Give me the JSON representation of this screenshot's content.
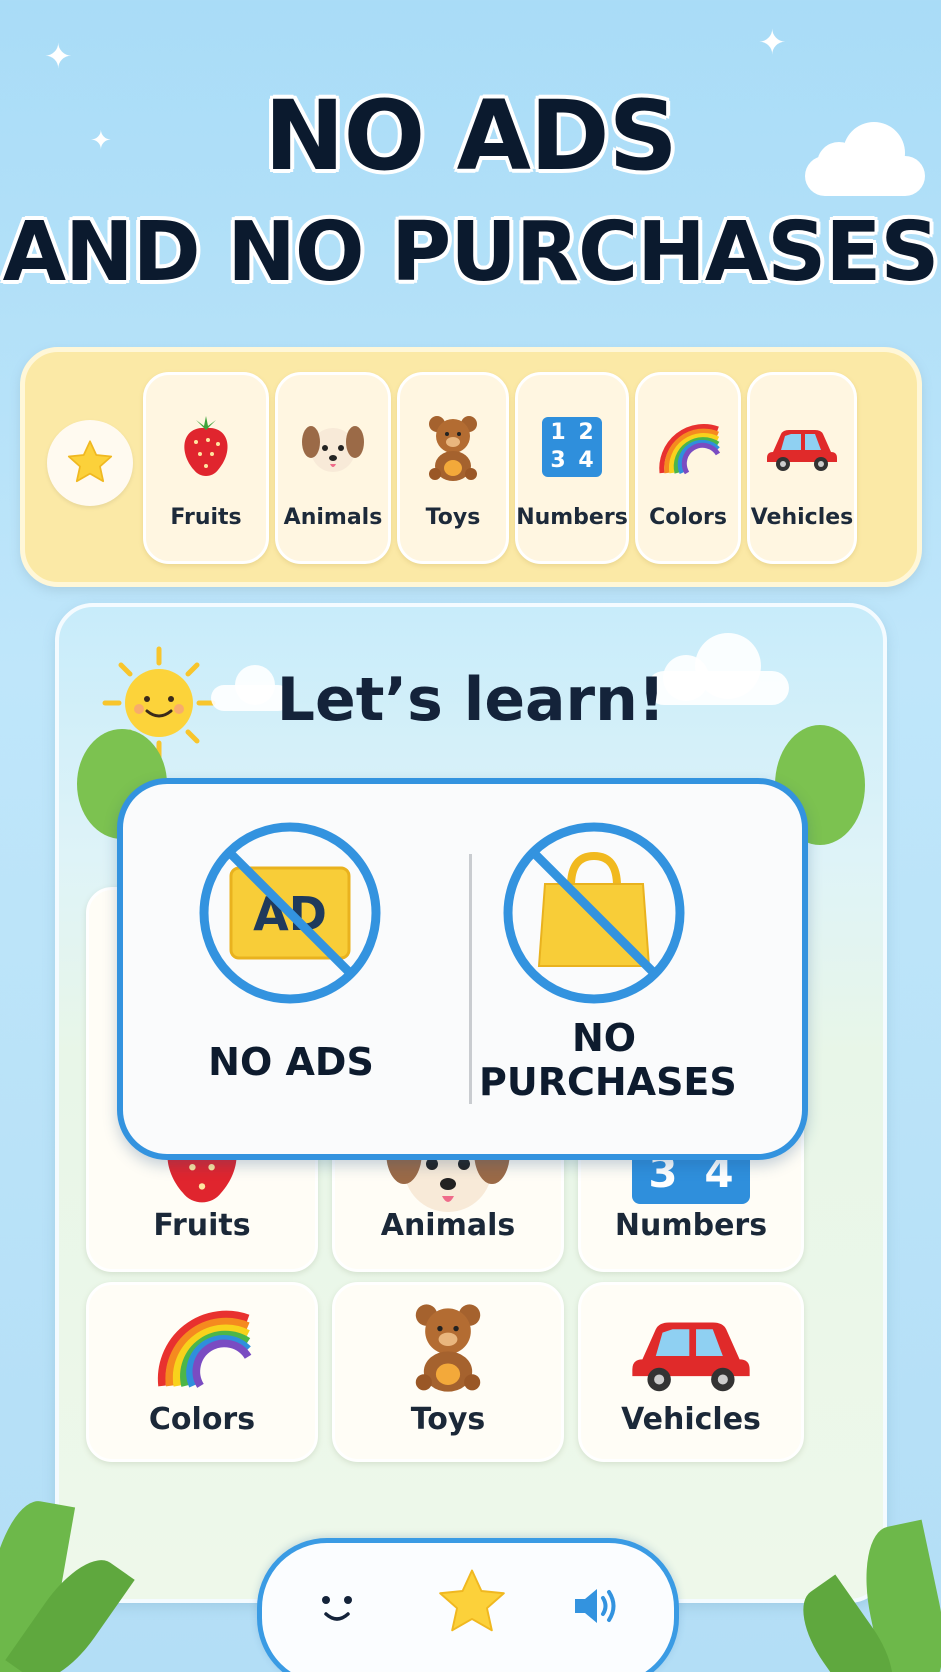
{
  "headline": {
    "line1": "NO ADS",
    "line2": "AND NO PURCHASES"
  },
  "category_strip": {
    "favorite_icon": "star-icon",
    "items": [
      {
        "label": "Fruits",
        "icon": "strawberry-icon"
      },
      {
        "label": "Animals",
        "icon": "puppy-icon"
      },
      {
        "label": "Toys",
        "icon": "teddy-bear-icon"
      },
      {
        "label": "Numbers",
        "icon": "numbers-icon"
      },
      {
        "label": "Colors",
        "icon": "rainbow-icon"
      },
      {
        "label": "Vehicles",
        "icon": "car-icon"
      }
    ]
  },
  "main": {
    "title": "Let’s learn!",
    "grid": [
      {
        "label": "Fruits",
        "icon": "strawberry-icon"
      },
      {
        "label": "Animals",
        "icon": "puppy-icon"
      },
      {
        "label": "Numbers",
        "icon": "numbers-icon"
      },
      {
        "label": "Colors",
        "icon": "rainbow-icon"
      },
      {
        "label": "Toys",
        "icon": "teddy-bear-icon"
      },
      {
        "label": "Vehicles",
        "icon": "car-icon"
      }
    ]
  },
  "notice": {
    "no_ads_label": "NO ADS",
    "no_ads_icon_text": "AD",
    "no_purchases_line1": "NO",
    "no_purchases_line2": "PURCHASES"
  },
  "number_tile": {
    "digits": [
      "1",
      "2",
      "3",
      "4"
    ]
  },
  "bottom_bar": {
    "items": [
      "smiley-icon",
      "star-icon",
      "speaker-icon"
    ]
  },
  "colors": {
    "accent_blue": "#3393df",
    "strip_yellow": "#fbe9a6",
    "star_yellow": "#fcd13a"
  }
}
